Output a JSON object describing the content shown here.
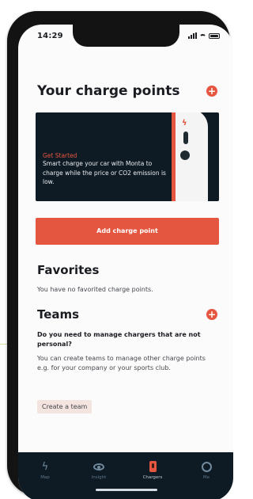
{
  "status_bar": {
    "time": "14:29"
  },
  "header": {
    "title": "Your charge points",
    "add_icon": "plus-circle-icon"
  },
  "banner": {
    "eyebrow": "Get Started",
    "body": "Smart charge your car with Monta to charge while the price or CO2 emission is low."
  },
  "add_charge_point": {
    "label": "Add charge point"
  },
  "favorites": {
    "title": "Favorites",
    "empty_text": "You have no favorited charge points."
  },
  "teams": {
    "title": "Teams",
    "question": "Do you need to manage chargers that are not personal?",
    "description": "You can create teams to manage other charge points e.g. for your company or your sports club.",
    "create_label": "Create a team"
  },
  "tab_bar": {
    "tabs": [
      {
        "label": "Map",
        "icon": "lightning-icon"
      },
      {
        "label": "Insight",
        "icon": "eye-icon"
      },
      {
        "label": "Chargers",
        "icon": "charger-icon"
      },
      {
        "label": "Me",
        "icon": "user-icon"
      }
    ],
    "active": "Chargers"
  },
  "colors": {
    "accent": "#e4563f",
    "dark": "#0f1b24",
    "background": "#fbfbfb"
  }
}
